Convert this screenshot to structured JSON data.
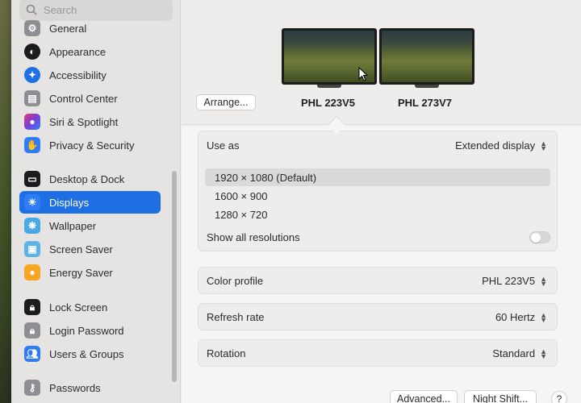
{
  "search": {
    "placeholder": "Search"
  },
  "sidebar": {
    "items": [
      {
        "label": "General",
        "icon": "gear-icon",
        "color": "#8e8e93"
      },
      {
        "label": "Appearance",
        "icon": "appearance-icon",
        "color": "#1c1c1e"
      },
      {
        "label": "Accessibility",
        "icon": "accessibility-icon",
        "color": "#1f6fe4"
      },
      {
        "label": "Control Center",
        "icon": "control-center-icon",
        "color": "#8e8e93"
      },
      {
        "label": "Siri & Spotlight",
        "icon": "siri-icon",
        "color": "#7b3fd6"
      },
      {
        "label": "Privacy & Security",
        "icon": "hand-icon",
        "color": "#2f7cf6"
      },
      {
        "label": "Desktop & Dock",
        "icon": "dock-icon",
        "color": "#1c1c1e"
      },
      {
        "label": "Displays",
        "icon": "sun-icon",
        "color": "#2f7cf6"
      },
      {
        "label": "Wallpaper",
        "icon": "wallpaper-icon",
        "color": "#49a8e6"
      },
      {
        "label": "Screen Saver",
        "icon": "screen-saver-icon",
        "color": "#5ab4e8"
      },
      {
        "label": "Energy Saver",
        "icon": "bulb-icon",
        "color": "#f5a623"
      },
      {
        "label": "Lock Screen",
        "icon": "lock-icon",
        "color": "#1c1c1e"
      },
      {
        "label": "Login Password",
        "icon": "lock-icon",
        "color": "#8e8e93"
      },
      {
        "label": "Users & Groups",
        "icon": "users-icon",
        "color": "#2f7cf6"
      },
      {
        "label": "Passwords",
        "icon": "key-icon",
        "color": "#8e8e93"
      }
    ],
    "active": "Displays"
  },
  "displays": {
    "arrange_label": "Arrange...",
    "monitors": [
      "PHL 223V5",
      "PHL 273V7"
    ],
    "selected_monitor": "PHL 223V5"
  },
  "settings": {
    "use_as": {
      "label": "Use as",
      "value": "Extended display"
    },
    "resolutions": [
      "1920 × 1080 (Default)",
      "1600 × 900",
      "1280 × 720"
    ],
    "selected_resolution": "1920 × 1080 (Default)",
    "show_all": {
      "label": "Show all resolutions",
      "on": false
    },
    "color_profile": {
      "label": "Color profile",
      "value": "PHL 223V5"
    },
    "refresh_rate": {
      "label": "Refresh rate",
      "value": "60 Hertz"
    },
    "rotation": {
      "label": "Rotation",
      "value": "Standard"
    }
  },
  "footer": {
    "advanced": "Advanced...",
    "night_shift": "Night Shift...",
    "help": "?"
  },
  "colors": {
    "accent": "#1f6fe4"
  }
}
